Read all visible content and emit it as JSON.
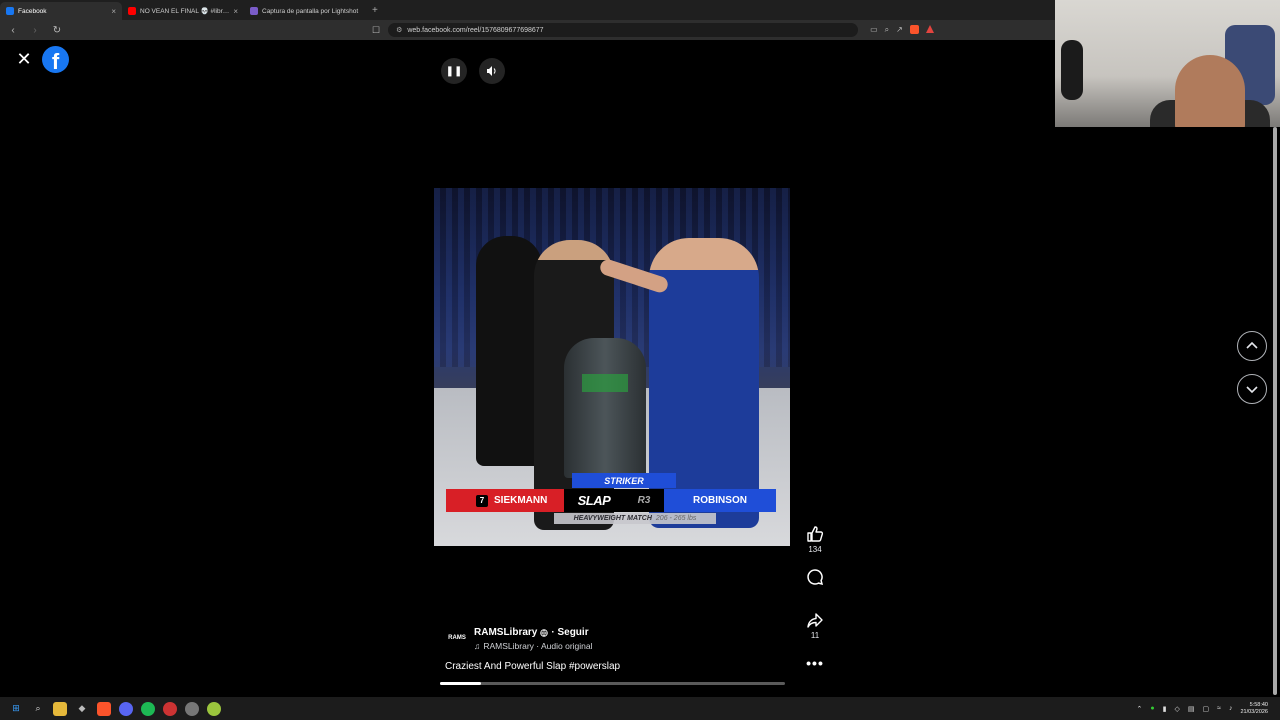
{
  "browser": {
    "tabs": [
      {
        "title": "Facebook",
        "icon": "facebook-icon",
        "active": true
      },
      {
        "title": "NO VEAN EL FINAL 💀 #libros #fe",
        "icon": "youtube-icon",
        "active": false
      },
      {
        "title": "Captura de pantalla por Lightshot",
        "icon": "feather-icon",
        "active": false
      }
    ],
    "new_tab": "+",
    "url": "web.facebook.com/reel/1576809677698677",
    "tab_close": "×"
  },
  "reel": {
    "author": "RAMSLibrary",
    "follow": "· Seguir",
    "audio_label": "RAMSLibrary · Audio original",
    "caption": "Craziest And Powerful Slap",
    "hashtag": "#powerslap",
    "likes": "134",
    "shares": "11",
    "progress": 0.12
  },
  "video_overlay": {
    "striker": "STRIKER",
    "left_number": "7",
    "left_name": "SIEKMANN",
    "brand": "SLAP",
    "round": "R3",
    "right_name": "ROBINSON",
    "match": "HEAVYWEIGHT MATCH",
    "weight_range": "206 - 265 lbs"
  },
  "system": {
    "time": "5:58:40",
    "date": "21/03/2026"
  },
  "colors": {
    "facebook_blue": "#1877f2",
    "slap_red": "#d81f26",
    "slap_blue": "#1f4ed8"
  }
}
